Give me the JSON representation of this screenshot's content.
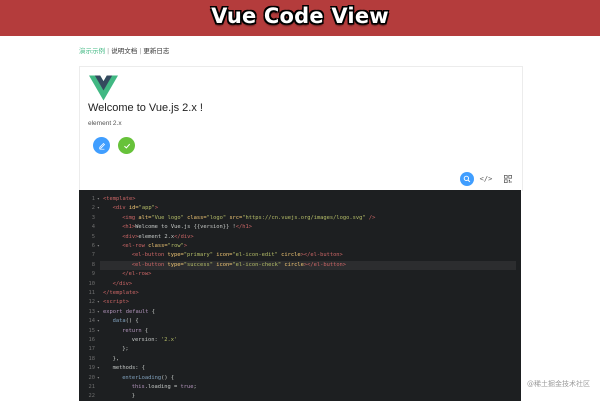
{
  "banner": {
    "title": "Vue Code View"
  },
  "nav": {
    "items": [
      "演示示例",
      "说明文档",
      "更新日志"
    ],
    "active_index": 0
  },
  "demo": {
    "heading": "Welcome to Vue.js 2.x !",
    "version_text": "element 2.x",
    "edit_icon": "edit-icon",
    "check_icon": "check-icon",
    "accent_primary": "#409eff",
    "accent_success": "#67c23a",
    "brand_green": "#41b883"
  },
  "toolbar": {
    "icons": [
      "search-icon",
      "code-icon",
      "qrcode-icon"
    ]
  },
  "code": {
    "lines": [
      {
        "n": "1",
        "fold": "▾",
        "indent": 0,
        "parts": [
          [
            "tag",
            "<template>"
          ]
        ]
      },
      {
        "n": "2",
        "fold": "▾",
        "indent": 1,
        "parts": [
          [
            "tag",
            "<div "
          ],
          [
            "attr",
            "id="
          ],
          [
            "str",
            "\"app\""
          ],
          [
            "tag",
            ">"
          ]
        ]
      },
      {
        "n": "3",
        "fold": "",
        "indent": 2,
        "parts": [
          [
            "tag",
            "<img "
          ],
          [
            "attr",
            "alt="
          ],
          [
            "str",
            "\"Vue logo\" "
          ],
          [
            "attr",
            "class="
          ],
          [
            "str",
            "\"logo\" "
          ],
          [
            "attr",
            "src="
          ],
          [
            "str",
            "\"https://cn.vuejs.org/images/logo.svg\" "
          ],
          [
            "tag",
            "/>"
          ]
        ]
      },
      {
        "n": "4",
        "fold": "",
        "indent": 2,
        "parts": [
          [
            "tag",
            "<h1>"
          ],
          [
            "pl",
            "Welcome to Vue.js {{version}} !"
          ],
          [
            "tag",
            "</h1>"
          ]
        ]
      },
      {
        "n": "5",
        "fold": "",
        "indent": 2,
        "parts": [
          [
            "tag",
            "<div>"
          ],
          [
            "pl",
            "element 2.x"
          ],
          [
            "tag",
            "</div>"
          ]
        ]
      },
      {
        "n": "6",
        "fold": "▾",
        "indent": 2,
        "parts": [
          [
            "tag",
            "<el-row "
          ],
          [
            "attr",
            "class="
          ],
          [
            "str",
            "\"row\""
          ],
          [
            "tag",
            ">"
          ]
        ]
      },
      {
        "n": "7",
        "fold": "",
        "indent": 3,
        "parts": [
          [
            "tag",
            "<el-button "
          ],
          [
            "attr",
            "type="
          ],
          [
            "str",
            "\"primary\" "
          ],
          [
            "attr",
            "icon="
          ],
          [
            "str",
            "\"el-icon-edit\" "
          ],
          [
            "attr",
            "circle"
          ],
          [
            "tag",
            "></el-button>"
          ]
        ]
      },
      {
        "n": "8",
        "fold": "",
        "indent": 3,
        "hl": true,
        "parts": [
          [
            "tag",
            "<el-button "
          ],
          [
            "attr",
            "type="
          ],
          [
            "str",
            "\"success\" "
          ],
          [
            "attr",
            "icon="
          ],
          [
            "str",
            "\"el-icon-check\" "
          ],
          [
            "attr",
            "circle"
          ],
          [
            "tag",
            "></el-button>"
          ]
        ]
      },
      {
        "n": "9",
        "fold": "",
        "indent": 2,
        "parts": [
          [
            "tag",
            "</el-row>"
          ]
        ]
      },
      {
        "n": "10",
        "fold": "",
        "indent": 1,
        "parts": [
          [
            "tag",
            "</div>"
          ]
        ]
      },
      {
        "n": "11",
        "fold": "",
        "indent": 0,
        "parts": [
          [
            "tag",
            "</template>"
          ]
        ]
      },
      {
        "n": "12",
        "fold": "▾",
        "indent": 0,
        "parts": [
          [
            "tag",
            "<script>"
          ]
        ]
      },
      {
        "n": "13",
        "fold": "▾",
        "indent": 0,
        "parts": [
          [
            "kw",
            "export default "
          ],
          [
            "pl",
            "{"
          ]
        ]
      },
      {
        "n": "14",
        "fold": "▾",
        "indent": 1,
        "parts": [
          [
            "fn",
            "data"
          ],
          [
            "pl",
            "() {"
          ]
        ]
      },
      {
        "n": "15",
        "fold": "▾",
        "indent": 2,
        "parts": [
          [
            "kw",
            "return "
          ],
          [
            "pl",
            "{"
          ]
        ]
      },
      {
        "n": "16",
        "fold": "",
        "indent": 3,
        "parts": [
          [
            "pl",
            "version: "
          ],
          [
            "str",
            "'2.x'"
          ]
        ]
      },
      {
        "n": "17",
        "fold": "",
        "indent": 2,
        "parts": [
          [
            "pl",
            "};"
          ]
        ]
      },
      {
        "n": "18",
        "fold": "",
        "indent": 1,
        "parts": [
          [
            "pl",
            "},"
          ]
        ]
      },
      {
        "n": "19",
        "fold": "▾",
        "indent": 1,
        "parts": [
          [
            "pl",
            "methods: {"
          ]
        ]
      },
      {
        "n": "20",
        "fold": "▾",
        "indent": 2,
        "parts": [
          [
            "fn",
            "enterLoading"
          ],
          [
            "pl",
            "() {"
          ]
        ]
      },
      {
        "n": "21",
        "fold": "",
        "indent": 3,
        "parts": [
          [
            "kw",
            "this"
          ],
          [
            "pl",
            ".loading = "
          ],
          [
            "kw",
            "true"
          ],
          [
            "pl",
            ";"
          ]
        ]
      },
      {
        "n": "22",
        "fold": "",
        "indent": 3,
        "parts": [
          [
            "pl",
            "}"
          ]
        ]
      }
    ]
  },
  "watermark": "@稀土掘金技术社区"
}
